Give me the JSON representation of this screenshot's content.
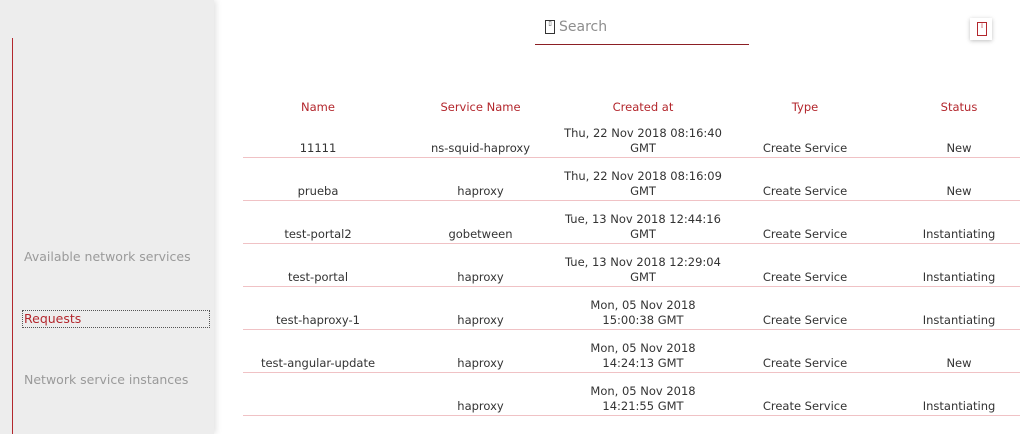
{
  "sidebar": {
    "items": [
      {
        "label": "Available network services"
      },
      {
        "label": "Requests"
      },
      {
        "label": "Network service instances"
      }
    ]
  },
  "search": {
    "placeholder": "Search"
  },
  "table": {
    "headers": [
      "Name",
      "Service Name",
      "Created at",
      "Type",
      "Status"
    ],
    "rows": [
      {
        "name": "11111",
        "service": "ns-squid-haproxy",
        "created": "Thu, 22 Nov 2018 08:16:40 GMT",
        "type": "Create Service",
        "status": "New"
      },
      {
        "name": "prueba",
        "service": "haproxy",
        "created": "Thu, 22 Nov 2018 08:16:09 GMT",
        "type": "Create Service",
        "status": "New"
      },
      {
        "name": "test-portal2",
        "service": "gobetween",
        "created": "Tue, 13 Nov 2018 12:44:16 GMT",
        "type": "Create Service",
        "status": "Instantiating"
      },
      {
        "name": "test-portal",
        "service": "haproxy",
        "created": "Tue, 13 Nov 2018 12:29:04 GMT",
        "type": "Create Service",
        "status": "Instantiating"
      },
      {
        "name": "test-haproxy-1",
        "service": "haproxy",
        "created": "Mon, 05 Nov 2018 15:00:38 GMT",
        "type": "Create Service",
        "status": "Instantiating"
      },
      {
        "name": "test-angular-update",
        "service": "haproxy",
        "created": "Mon, 05 Nov 2018 14:24:13 GMT",
        "type": "Create Service",
        "status": "New"
      },
      {
        "name": "",
        "service": "haproxy",
        "created": "Mon, 05 Nov 2018 14:21:55 GMT",
        "type": "Create Service",
        "status": "Instantiating"
      }
    ]
  },
  "colors": {
    "accent": "#b3272d",
    "sidebar_bg": "#ededed",
    "row_divider": "#f0c2c5"
  }
}
